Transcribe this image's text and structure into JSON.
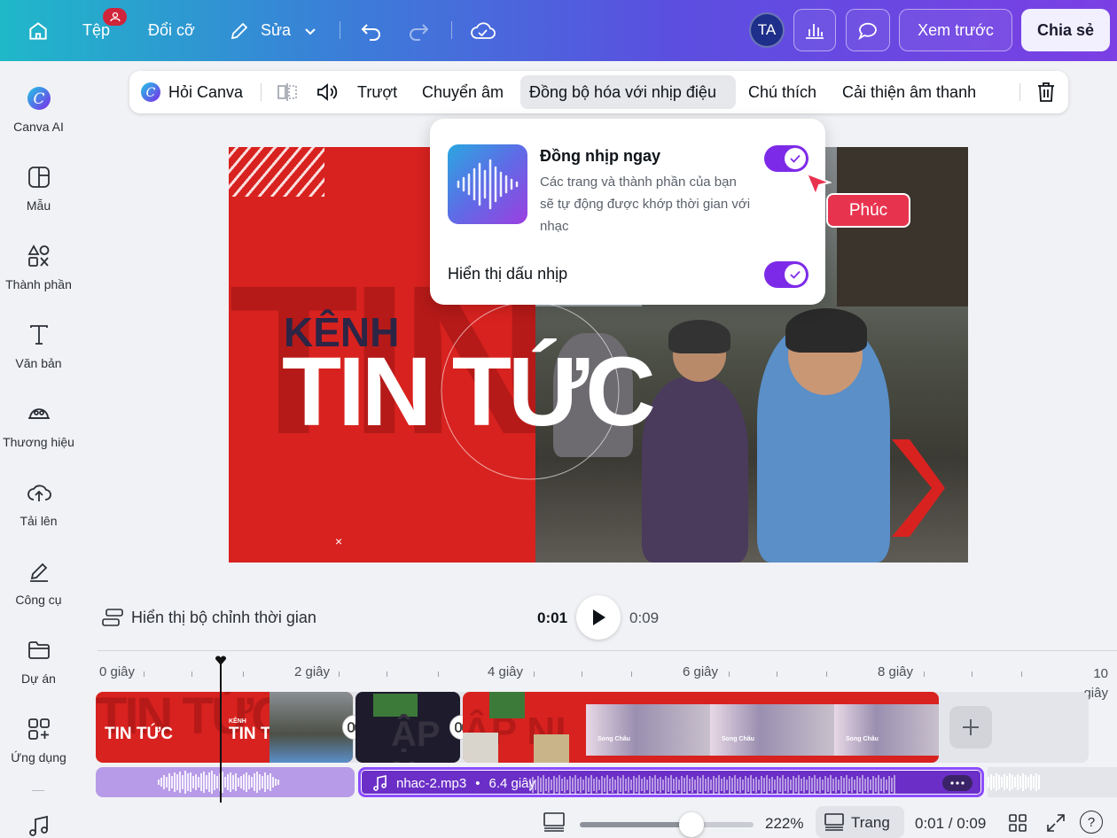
{
  "topbar": {
    "file": "Tệp",
    "resize": "Đổi cỡ",
    "edit": "Sửa",
    "avatar": "TA",
    "preview": "Xem trước",
    "share": "Chia sẻ"
  },
  "sidebar": {
    "items": [
      {
        "label": "Canva AI",
        "icon": "canva-ai-icon"
      },
      {
        "label": "Mẫu",
        "icon": "template-icon"
      },
      {
        "label": "Thành phần",
        "icon": "elements-icon"
      },
      {
        "label": "Văn bản",
        "icon": "text-icon"
      },
      {
        "label": "Thương hiệu",
        "icon": "brand-icon"
      },
      {
        "label": "Tải lên",
        "icon": "upload-icon"
      },
      {
        "label": "Công cụ",
        "icon": "tools-icon"
      },
      {
        "label": "Dự án",
        "icon": "folder-icon"
      },
      {
        "label": "Ứng dụng",
        "icon": "apps-icon"
      }
    ]
  },
  "context_toolbar": {
    "ask_canva": "Hỏi Canva",
    "slide": "Trượt",
    "transcribe": "Chuyển âm",
    "beat_sync": "Đồng bộ hóa với nhịp điệu",
    "caption": "Chú thích",
    "enhance_audio": "Cải thiện âm thanh"
  },
  "canvas": {
    "kenh": "KÊNH",
    "title": "TIN TỨC",
    "ghost": "TIN",
    "close": "×"
  },
  "beat_popup": {
    "title": "Đồng nhịp ngay",
    "description": "Các trang và thành phần của bạn sẽ tự động được khớp thời gian với nhạc",
    "sync_on": true,
    "show_beats_label": "Hiển thị dấu nhịp",
    "show_beats_on": true
  },
  "cursor": {
    "name": "Phúc",
    "color": "#e8334f"
  },
  "player": {
    "timing_editor": "Hiển thị bộ chỉnh thời gian",
    "current": "0:01",
    "total": "0:09"
  },
  "timeline": {
    "ticks": [
      "0 giây",
      "2 giây",
      "4 giây",
      "6 giây",
      "8 giây",
      "10 giây"
    ],
    "clip1_label": "TIN TỨC",
    "clip1b_kenh": "KÊNH",
    "clip1b_label": "TIN TỨC",
    "clip_small_caption": "Song Châu",
    "audio_name": "nhac-2.mp3",
    "audio_duration": "6.4 giây"
  },
  "bottom": {
    "zoom": "222%",
    "page_label": "Trang",
    "time": "0:01 / 0:09",
    "help": "?"
  },
  "colors": {
    "accent": "#7d2ae8",
    "canvas_red": "#d8221f"
  }
}
